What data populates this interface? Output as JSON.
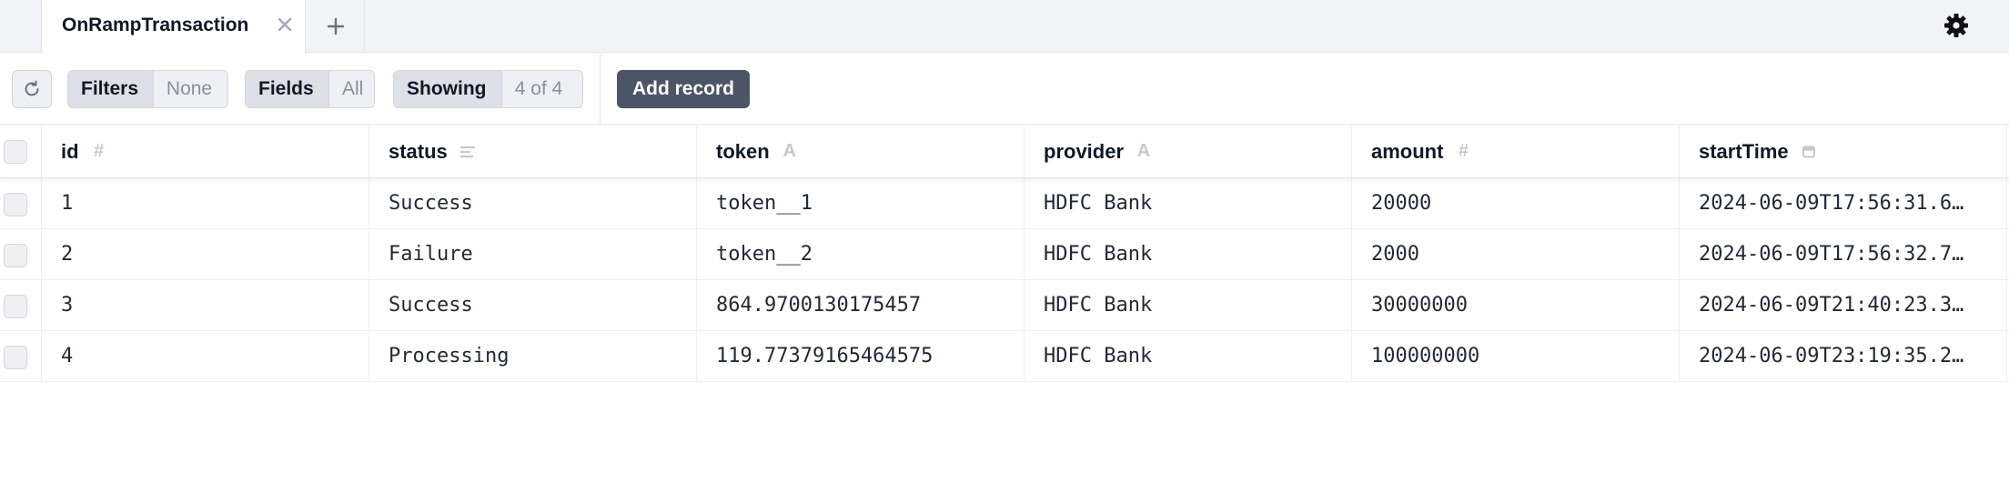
{
  "tabs": {
    "active_label": "OnRampTransaction"
  },
  "toolbar": {
    "filters_label": "Filters",
    "filters_value": "None",
    "fields_label": "Fields",
    "fields_value": "All",
    "showing_label": "Showing",
    "showing_value": "4 of 4",
    "add_record_label": "Add record"
  },
  "table": {
    "columns": [
      {
        "label": "id",
        "type_icon": "hash-icon"
      },
      {
        "label": "status",
        "type_icon": "enum-list-icon"
      },
      {
        "label": "token",
        "type_icon": "text-a-icon"
      },
      {
        "label": "provider",
        "type_icon": "text-a-icon"
      },
      {
        "label": "amount",
        "type_icon": "hash-icon"
      },
      {
        "label": "startTime",
        "type_icon": "calendar-icon"
      }
    ],
    "rows": [
      [
        "1",
        "Success",
        "token__1",
        "HDFC Bank",
        "20000",
        "2024-06-09T17:56:31.6…"
      ],
      [
        "2",
        "Failure",
        "token__2",
        "HDFC Bank",
        "2000",
        "2024-06-09T17:56:32.7…"
      ],
      [
        "3",
        "Success",
        "864.9700130175457",
        "HDFC Bank",
        "30000000",
        "2024-06-09T21:40:23.3…"
      ],
      [
        "4",
        "Processing",
        "119.77379165464575",
        "HDFC Bank",
        "100000000",
        "2024-06-09T23:19:35.2…"
      ]
    ]
  },
  "colors": {
    "tabbar_bg": "#f1f3f7",
    "primary_button": "#4b5565",
    "muted_text": "#8a919c"
  }
}
